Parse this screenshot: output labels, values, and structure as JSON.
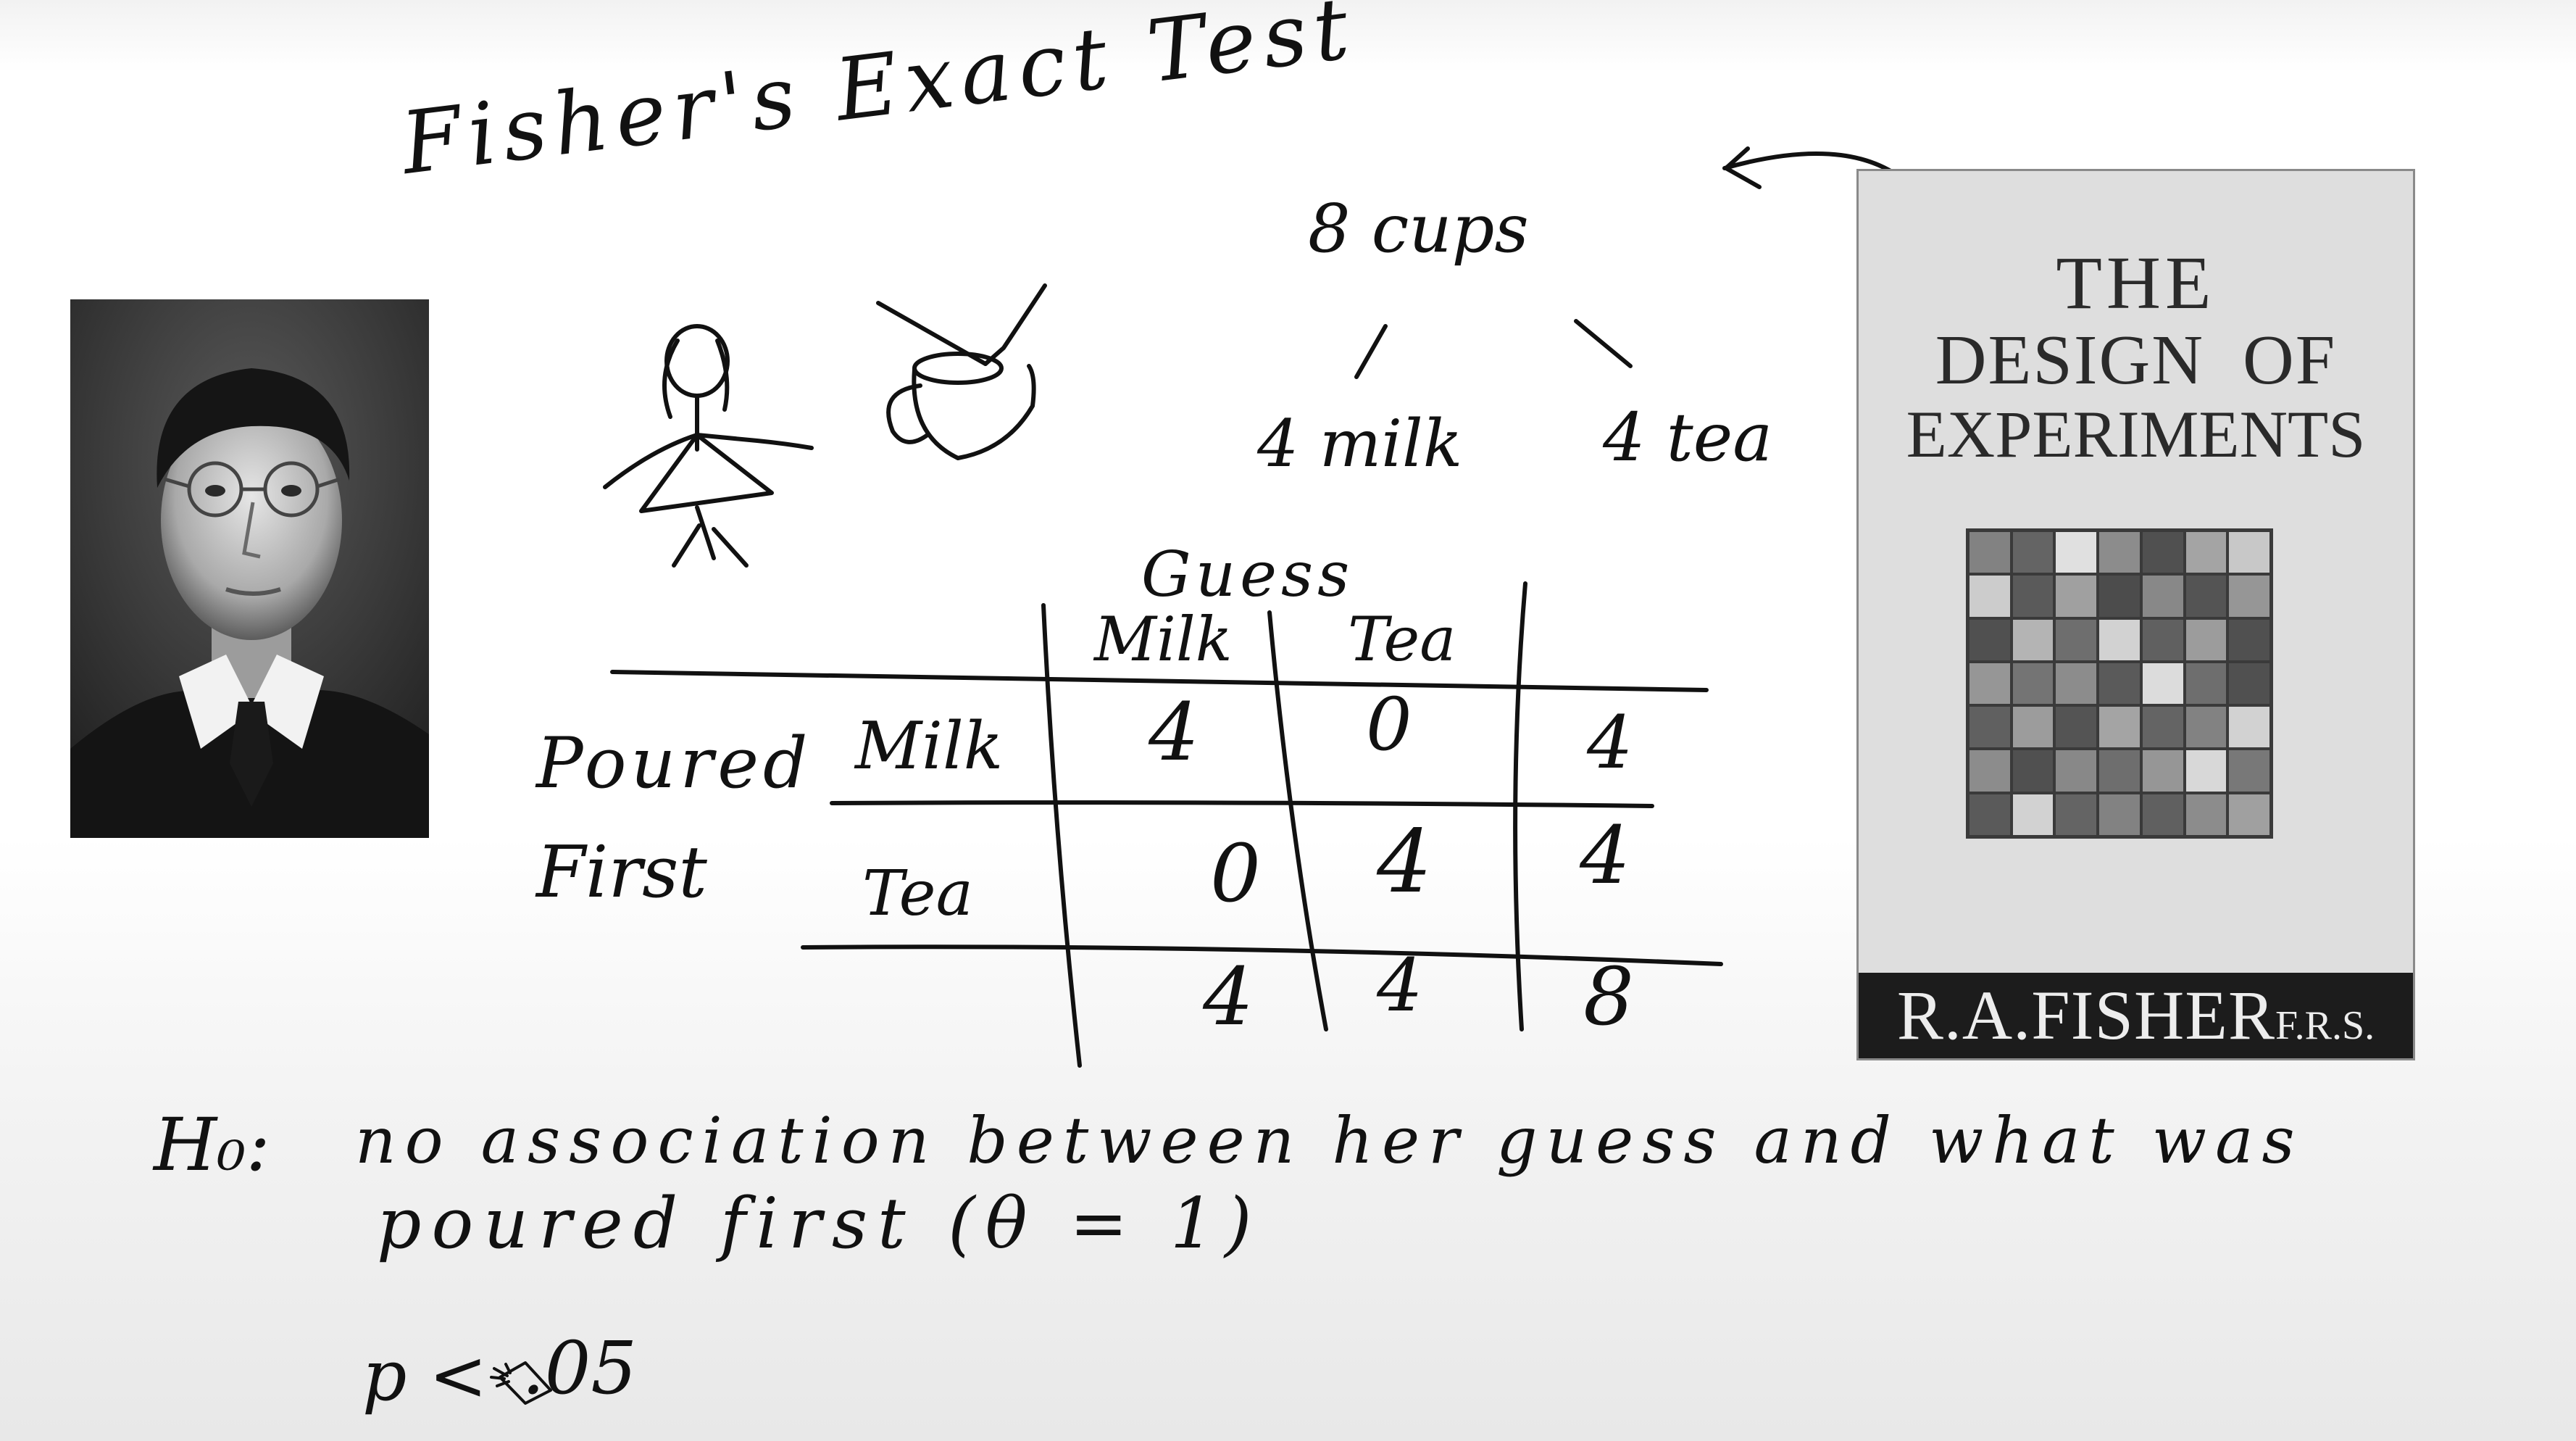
{
  "title": "Fisher's Exact Test",
  "cups": {
    "total": "8 cups",
    "milk": "4 milk",
    "tea": "4 tea"
  },
  "table": {
    "col_group": "Guess",
    "col_headers": [
      "Milk",
      "Tea"
    ],
    "row_group_line1": "Poured",
    "row_group_line2": "First",
    "rows": [
      {
        "label": "Milk",
        "values": [
          "4",
          "0"
        ],
        "total": "4"
      },
      {
        "label": "Tea",
        "values": [
          "0",
          "4"
        ],
        "total": "4"
      }
    ],
    "col_totals": [
      "4",
      "4"
    ],
    "grand_total": "8"
  },
  "hypothesis": {
    "label": "H₀:",
    "line1": "no association between her guess and what was",
    "line2": "poured first (θ = 1)"
  },
  "pvalue": {
    "prefix": "p <",
    "value": ".05"
  },
  "book": {
    "line1": "THE",
    "line2": "DESIGN  OF",
    "line3": "EXPERIMENTS",
    "author": "R.A.FISHER",
    "honor": "F.R.S.",
    "grid": [
      [
        0.45,
        0.3,
        0.92,
        0.5,
        0.2,
        0.62,
        0.8
      ],
      [
        0.82,
        0.25,
        0.6,
        0.18,
        0.48,
        0.22,
        0.55
      ],
      [
        0.2,
        0.7,
        0.35,
        0.85,
        0.28,
        0.58,
        0.2
      ],
      [
        0.55,
        0.38,
        0.5,
        0.25,
        0.9,
        0.35,
        0.2
      ],
      [
        0.28,
        0.58,
        0.22,
        0.62,
        0.3,
        0.45,
        0.85
      ],
      [
        0.5,
        0.2,
        0.48,
        0.35,
        0.55,
        0.88,
        0.4
      ],
      [
        0.25,
        0.85,
        0.3,
        0.45,
        0.28,
        0.5,
        0.6
      ]
    ]
  },
  "colors": {
    "ink": "#111111",
    "book_cover": "#dedede",
    "book_footer": "#1c1c1c"
  }
}
